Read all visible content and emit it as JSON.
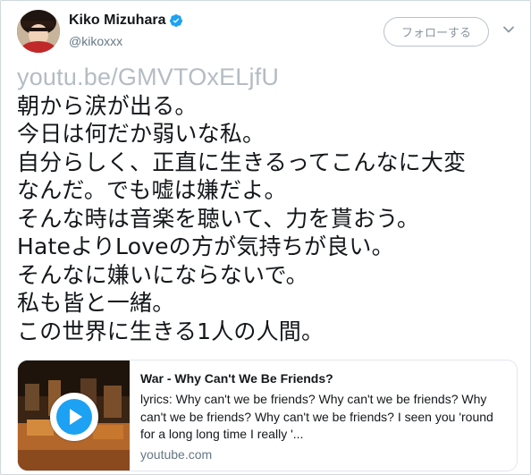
{
  "author": {
    "display_name": "Kiko Mizuhara",
    "handle": "@kikoxxx",
    "verified": true
  },
  "follow_button": {
    "label": "フォローする"
  },
  "tweet": {
    "link": "youtu.be/GMVTOxELjfU",
    "lines": [
      "朝から涙が出る。",
      "今日は何だか弱いな私。",
      "自分らしく、正直に生きるってこんなに大変",
      "なんだ。でも嘘は嫌だよ。",
      "そんな時は音楽を聴いて、力を貰おう。",
      "HateよりLoveの方が気持ちが良い。",
      "そんなに嫌いにならないで。",
      "私も皆と一緒。",
      "この世界に生きる1人の人間。"
    ]
  },
  "card": {
    "title": "War - Why Can't We Be Friends?",
    "description": "lyrics: Why can't we be friends? Why can't we be friends? Why can't we be friends? Why can't we be friends? I seen you 'round for a long long time I really '...",
    "domain": "youtube.com"
  },
  "icons": {
    "verified": "verified-badge-icon",
    "caret": "chevron-down-icon",
    "play": "play-icon"
  },
  "colors": {
    "accent": "#1da1f2",
    "text": "#14171a",
    "muted": "#657786",
    "link_faded": "#b4bcc3"
  }
}
